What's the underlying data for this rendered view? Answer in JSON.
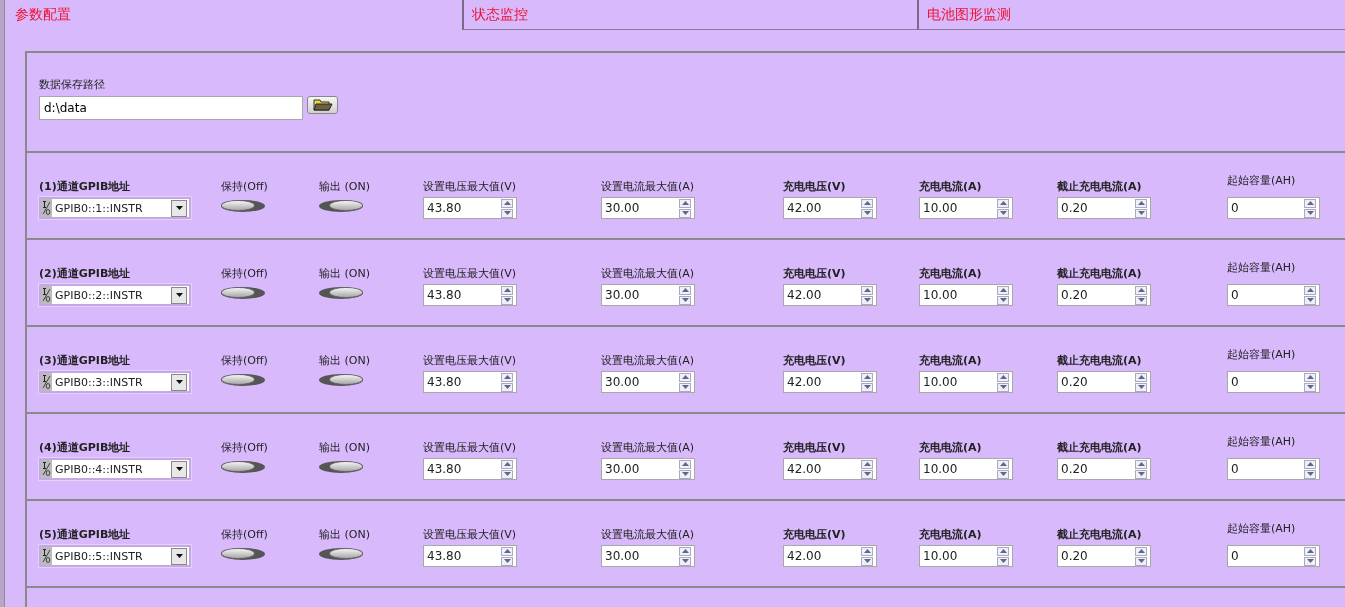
{
  "tabs": [
    {
      "label": "参数配置",
      "selected": true
    },
    {
      "label": "状态监控",
      "selected": false
    },
    {
      "label": "电池图形监测",
      "selected": false
    }
  ],
  "save_path": {
    "label": "数据保存路径",
    "value": "d:\\data"
  },
  "channels": [
    {
      "address_label": "(1)通道GPIB地址",
      "address": "GPIB0::1::INSTR",
      "hold": {
        "label": "保持(Off)",
        "on": false
      },
      "output": {
        "label": "输出 (ON)",
        "on": true
      },
      "fields": [
        {
          "label": "设置电压最大值(V)",
          "value": "43.80",
          "bold": false
        },
        {
          "label": "设置电流最大值(A)",
          "value": "30.00",
          "bold": false
        },
        {
          "label": "充电电压(V)",
          "value": "42.00",
          "bold": true
        },
        {
          "label": "充电电流(A)",
          "value": "10.00",
          "bold": true
        },
        {
          "label": "截止充电电流(A)",
          "value": "0.20",
          "bold": true
        },
        {
          "label": "起始容量(AH)",
          "value": "0",
          "bold": false
        }
      ]
    },
    {
      "address_label": "(2)通道GPIB地址",
      "address": "GPIB0::2::INSTR",
      "hold": {
        "label": "保持(Off)",
        "on": false
      },
      "output": {
        "label": "输出 (ON)",
        "on": true
      },
      "fields": [
        {
          "label": "设置电压最大值(V)",
          "value": "43.80",
          "bold": false
        },
        {
          "label": "设置电流最大值(A)",
          "value": "30.00",
          "bold": false
        },
        {
          "label": "充电电压(V)",
          "value": "42.00",
          "bold": true
        },
        {
          "label": "充电电流(A)",
          "value": "10.00",
          "bold": true
        },
        {
          "label": "截止充电电流(A)",
          "value": "0.20",
          "bold": true
        },
        {
          "label": "起始容量(AH)",
          "value": "0",
          "bold": false
        }
      ]
    },
    {
      "address_label": "(3)通道GPIB地址",
      "address": "GPIB0::3::INSTR",
      "hold": {
        "label": "保持(Off)",
        "on": false
      },
      "output": {
        "label": "输出 (ON)",
        "on": true
      },
      "fields": [
        {
          "label": "设置电压最大值(V)",
          "value": "43.80",
          "bold": false
        },
        {
          "label": "设置电流最大值(A)",
          "value": "30.00",
          "bold": false
        },
        {
          "label": "充电电压(V)",
          "value": "42.00",
          "bold": true
        },
        {
          "label": "充电电流(A)",
          "value": "10.00",
          "bold": true
        },
        {
          "label": "截止充电电流(A)",
          "value": "0.20",
          "bold": true
        },
        {
          "label": "起始容量(AH)",
          "value": "0",
          "bold": false
        }
      ]
    },
    {
      "address_label": "(4)通道GPIB地址",
      "address": "GPIB0::4::INSTR",
      "hold": {
        "label": "保持(Off)",
        "on": false
      },
      "output": {
        "label": "输出 (ON)",
        "on": true
      },
      "fields": [
        {
          "label": "设置电压最大值(V)",
          "value": "43.80",
          "bold": false
        },
        {
          "label": "设置电流最大值(A)",
          "value": "30.00",
          "bold": false
        },
        {
          "label": "充电电压(V)",
          "value": "42.00",
          "bold": true
        },
        {
          "label": "充电电流(A)",
          "value": "10.00",
          "bold": true
        },
        {
          "label": "截止充电电流(A)",
          "value": "0.20",
          "bold": true
        },
        {
          "label": "起始容量(AH)",
          "value": "0",
          "bold": false
        }
      ]
    },
    {
      "address_label": "(5)通道GPIB地址",
      "address": "GPIB0::5::INSTR",
      "hold": {
        "label": "保持(Off)",
        "on": false
      },
      "output": {
        "label": "输出 (ON)",
        "on": true
      },
      "fields": [
        {
          "label": "设置电压最大值(V)",
          "value": "43.80",
          "bold": false
        },
        {
          "label": "设置电流最大值(A)",
          "value": "30.00",
          "bold": false
        },
        {
          "label": "充电电压(V)",
          "value": "42.00",
          "bold": true
        },
        {
          "label": "充电电流(A)",
          "value": "10.00",
          "bold": true
        },
        {
          "label": "截止充电电流(A)",
          "value": "0.20",
          "bold": true
        },
        {
          "label": "起始容量(AH)",
          "value": "0",
          "bold": false
        }
      ]
    }
  ]
}
